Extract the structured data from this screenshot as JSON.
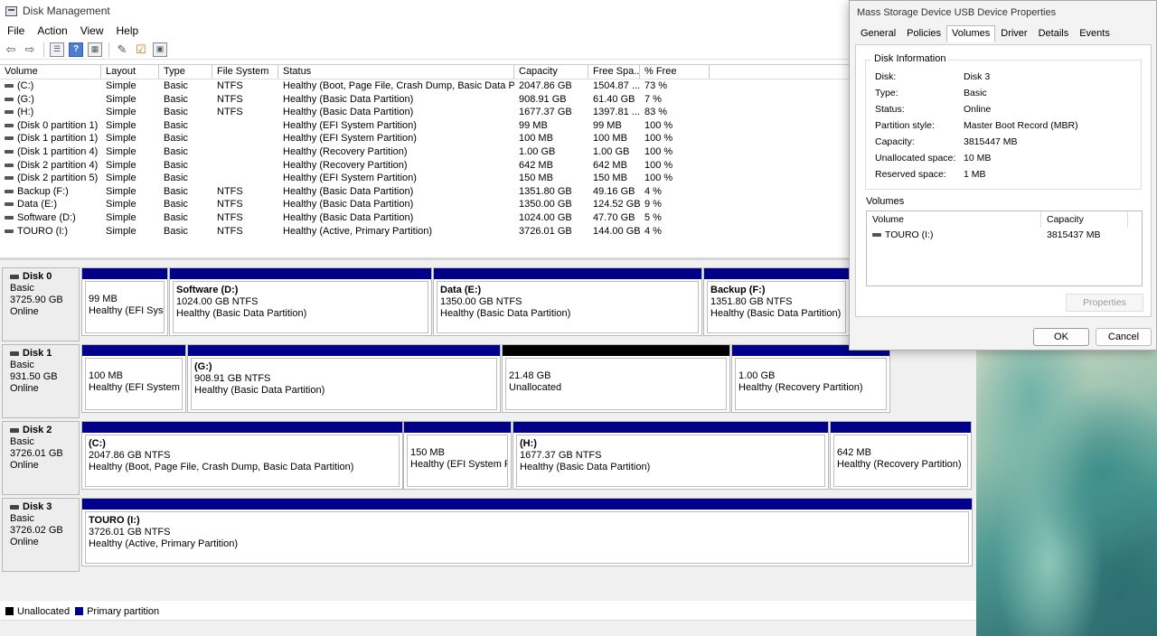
{
  "window": {
    "title": "Disk Management"
  },
  "menu": [
    "File",
    "Action",
    "View",
    "Help"
  ],
  "toolbar_icons": [
    "back-arrow-icon",
    "forward-arrow-icon",
    "list-icon",
    "help-icon",
    "properties-icon",
    "connect-icon",
    "check-icon",
    "console-icon"
  ],
  "columns": [
    "Volume",
    "Layout",
    "Type",
    "File System",
    "Status",
    "Capacity",
    "Free Spa...",
    "% Free"
  ],
  "volumes": [
    [
      "(C:)",
      "Simple",
      "Basic",
      "NTFS",
      "Healthy (Boot, Page File, Crash Dump, Basic Data Part...",
      "2047.86 GB",
      "1504.87 ...",
      "73 %"
    ],
    [
      "(G:)",
      "Simple",
      "Basic",
      "NTFS",
      "Healthy (Basic Data Partition)",
      "908.91 GB",
      "61.40 GB",
      "7 %"
    ],
    [
      "(H:)",
      "Simple",
      "Basic",
      "NTFS",
      "Healthy (Basic Data Partition)",
      "1677.37 GB",
      "1397.81 ...",
      "83 %"
    ],
    [
      "(Disk 0 partition 1)",
      "Simple",
      "Basic",
      "",
      "Healthy (EFI System Partition)",
      "99 MB",
      "99 MB",
      "100 %"
    ],
    [
      "(Disk 1 partition 1)",
      "Simple",
      "Basic",
      "",
      "Healthy (EFI System Partition)",
      "100 MB",
      "100 MB",
      "100 %"
    ],
    [
      "(Disk 1 partition 4)",
      "Simple",
      "Basic",
      "",
      "Healthy (Recovery Partition)",
      "1.00 GB",
      "1.00 GB",
      "100 %"
    ],
    [
      "(Disk 2 partition 4)",
      "Simple",
      "Basic",
      "",
      "Healthy (Recovery Partition)",
      "642 MB",
      "642 MB",
      "100 %"
    ],
    [
      "(Disk 2 partition 5)",
      "Simple",
      "Basic",
      "",
      "Healthy (EFI System Partition)",
      "150 MB",
      "150 MB",
      "100 %"
    ],
    [
      "Backup (F:)",
      "Simple",
      "Basic",
      "NTFS",
      "Healthy (Basic Data Partition)",
      "1351.80 GB",
      "49.16 GB",
      "4 %"
    ],
    [
      "Data (E:)",
      "Simple",
      "Basic",
      "NTFS",
      "Healthy (Basic Data Partition)",
      "1350.00 GB",
      "124.52 GB",
      "9 %"
    ],
    [
      "Software (D:)",
      "Simple",
      "Basic",
      "NTFS",
      "Healthy (Basic Data Partition)",
      "1024.00 GB",
      "47.70 GB",
      "5 %"
    ],
    [
      "TOURO (I:)",
      "Simple",
      "Basic",
      "NTFS",
      "Healthy (Active, Primary Partition)",
      "3726.01 GB",
      "144.00 GB",
      "4 %"
    ]
  ],
  "disks": [
    {
      "name": "Disk 0",
      "type": "Basic",
      "size": "3725.90 GB",
      "state": "Online",
      "partitions": [
        {
          "title": "",
          "line1": "99 MB",
          "line2": "Healthy (EFI System Partition)",
          "bar": "primary"
        },
        {
          "title": "Software  (D:)",
          "line1": "1024.00 GB NTFS",
          "line2": "Healthy (Basic Data Partition)",
          "bar": "primary"
        },
        {
          "title": "Data  (E:)",
          "line1": "1350.00 GB NTFS",
          "line2": "Healthy (Basic Data Partition)",
          "bar": "primary"
        },
        {
          "title": "Backup  (F:)",
          "line1": "1351.80 GB NTFS",
          "line2": "Healthy (Basic Data Partition)",
          "bar": "primary"
        }
      ]
    },
    {
      "name": "Disk 1",
      "type": "Basic",
      "size": "931.50 GB",
      "state": "Online",
      "partitions": [
        {
          "title": "",
          "line1": "100 MB",
          "line2": "Healthy (EFI System Partition)",
          "bar": "primary"
        },
        {
          "title": "(G:)",
          "line1": "908.91 GB NTFS",
          "line2": "Healthy (Basic Data Partition)",
          "bar": "primary"
        },
        {
          "title": "",
          "line1": "21.48 GB",
          "line2": "Unallocated",
          "bar": "unallocated"
        },
        {
          "title": "",
          "line1": "1.00 GB",
          "line2": "Healthy (Recovery Partition)",
          "bar": "primary"
        }
      ]
    },
    {
      "name": "Disk 2",
      "type": "Basic",
      "size": "3726.01 GB",
      "state": "Online",
      "partitions": [
        {
          "title": "(C:)",
          "line1": "2047.86 GB NTFS",
          "line2": "Healthy (Boot, Page File, Crash Dump, Basic Data Partition)",
          "bar": "primary"
        },
        {
          "title": "",
          "line1": "150 MB",
          "line2": "Healthy (EFI System Partition)",
          "bar": "primary"
        },
        {
          "title": "(H:)",
          "line1": "1677.37 GB NTFS",
          "line2": "Healthy (Basic Data Partition)",
          "bar": "primary"
        },
        {
          "title": "",
          "line1": "642 MB",
          "line2": "Healthy (Recovery Partition)",
          "bar": "primary"
        }
      ]
    },
    {
      "name": "Disk 3",
      "type": "Basic",
      "size": "3726.02 GB",
      "state": "Online",
      "partitions": [
        {
          "title": "TOURO  (I:)",
          "line1": "3726.01 GB NTFS",
          "line2": "Healthy (Active, Primary Partition)",
          "bar": "primary"
        }
      ]
    }
  ],
  "legend": {
    "unallocated": "Unallocated",
    "primary": "Primary partition"
  },
  "colors": {
    "primary": "#00008b",
    "unallocated": "#000000"
  },
  "dialog": {
    "title": "Mass Storage Device USB Device Properties",
    "tabs": [
      "General",
      "Policies",
      "Volumes",
      "Driver",
      "Details",
      "Events"
    ],
    "active_tab": "Volumes",
    "group_title": "Disk Information",
    "info": [
      [
        "Disk:",
        "Disk 3"
      ],
      [
        "Type:",
        "Basic"
      ],
      [
        "Status:",
        "Online"
      ],
      [
        "Partition style:",
        "Master Boot Record (MBR)"
      ],
      [
        "Capacity:",
        "3815447 MB"
      ],
      [
        "Unallocated space:",
        "10 MB"
      ],
      [
        "Reserved space:",
        "1 MB"
      ]
    ],
    "volumes_label": "Volumes",
    "vol_headers": [
      "Volume",
      "Capacity"
    ],
    "vol_rows": [
      [
        "TOURO (I:)",
        "3815437 MB"
      ]
    ],
    "properties_button": "Properties",
    "ok": "OK",
    "cancel": "Cancel"
  }
}
